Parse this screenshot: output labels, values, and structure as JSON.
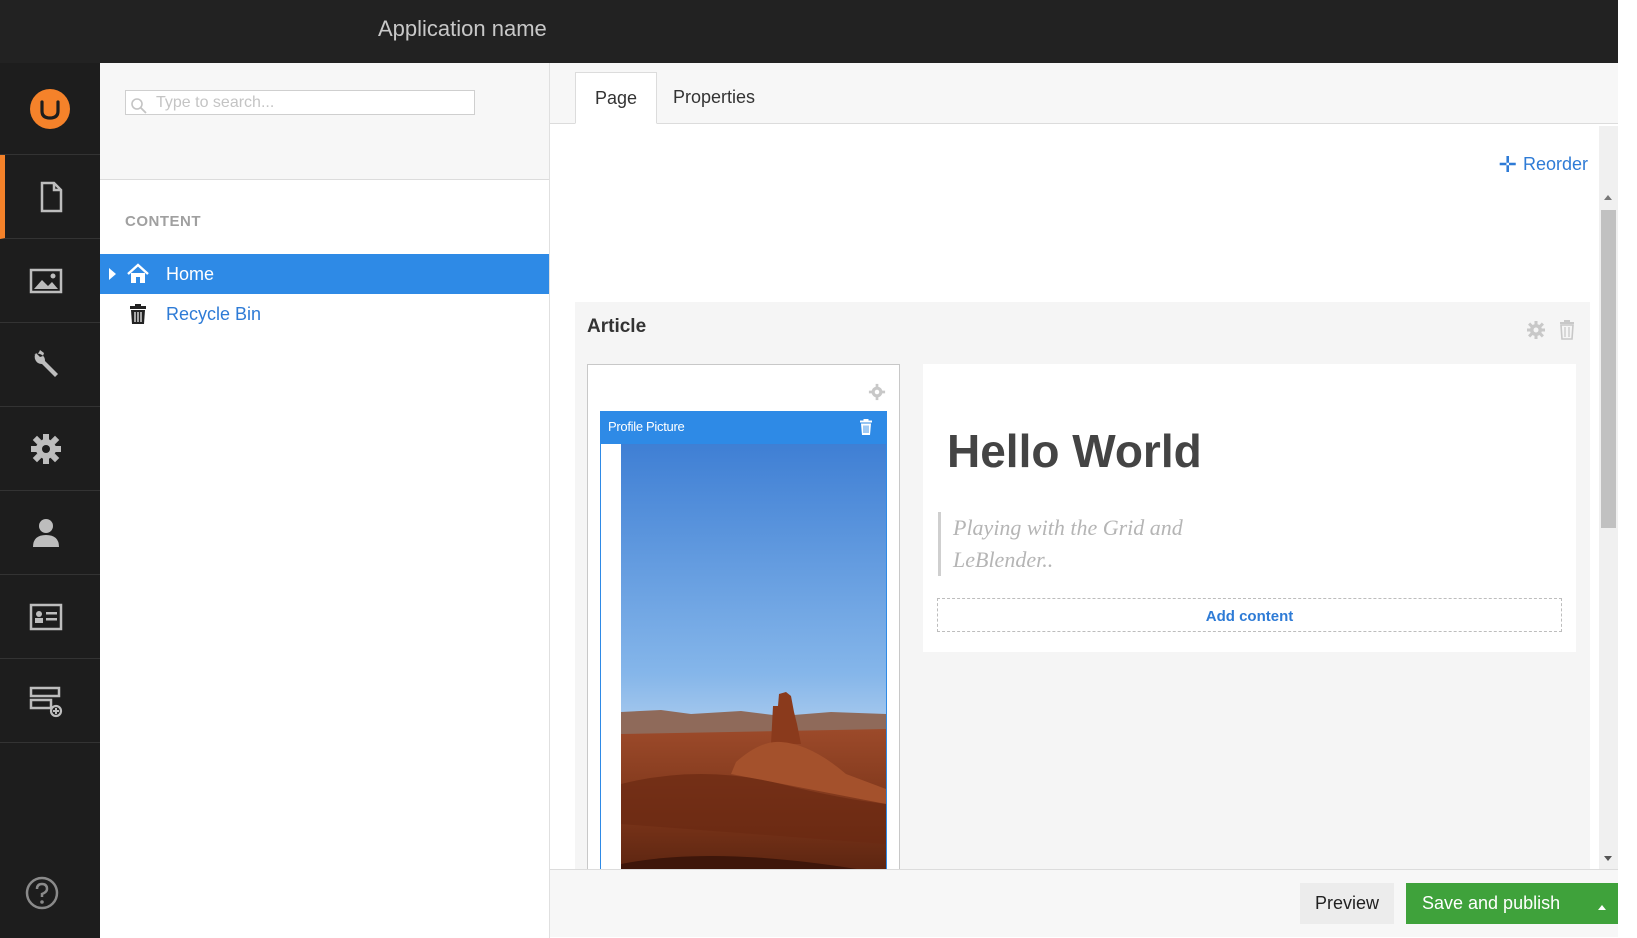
{
  "app": {
    "title": "Application name"
  },
  "nav": {
    "items": [
      {
        "name": "content",
        "icon": "document-icon",
        "active": true
      },
      {
        "name": "media",
        "icon": "image-icon"
      },
      {
        "name": "settings",
        "icon": "wrench-icon"
      },
      {
        "name": "developer",
        "icon": "gear-icon"
      },
      {
        "name": "users",
        "icon": "user-icon"
      },
      {
        "name": "members",
        "icon": "member-card-icon"
      },
      {
        "name": "forms",
        "icon": "form-add-icon"
      }
    ],
    "help_icon": "help-icon",
    "accent": "#f5822a"
  },
  "tree": {
    "search_placeholder": "Type to search...",
    "section_label": "CONTENT",
    "items": [
      {
        "label": "Home",
        "icon": "home-icon",
        "selected": true
      },
      {
        "label": "Recycle Bin",
        "icon": "trash-icon",
        "selected": false
      }
    ]
  },
  "editor": {
    "tabs": [
      {
        "label": "Page",
        "active": true
      },
      {
        "label": "Properties",
        "active": false
      }
    ],
    "reorder_label": "Reorder",
    "grid": {
      "title": "Article",
      "left_cell": {
        "widget_label": "Profile Picture"
      },
      "right_cell": {
        "heading": "Hello World",
        "quote": "Playing with the Grid and LeBlender..",
        "add_content_label": "Add content"
      }
    }
  },
  "footer": {
    "preview_label": "Preview",
    "save_label": "Save and publish"
  },
  "colors": {
    "primary_blue": "#2e8ae6",
    "link_blue": "#2e7bd6",
    "save_green": "#3fa23b",
    "topbar": "#222222"
  }
}
